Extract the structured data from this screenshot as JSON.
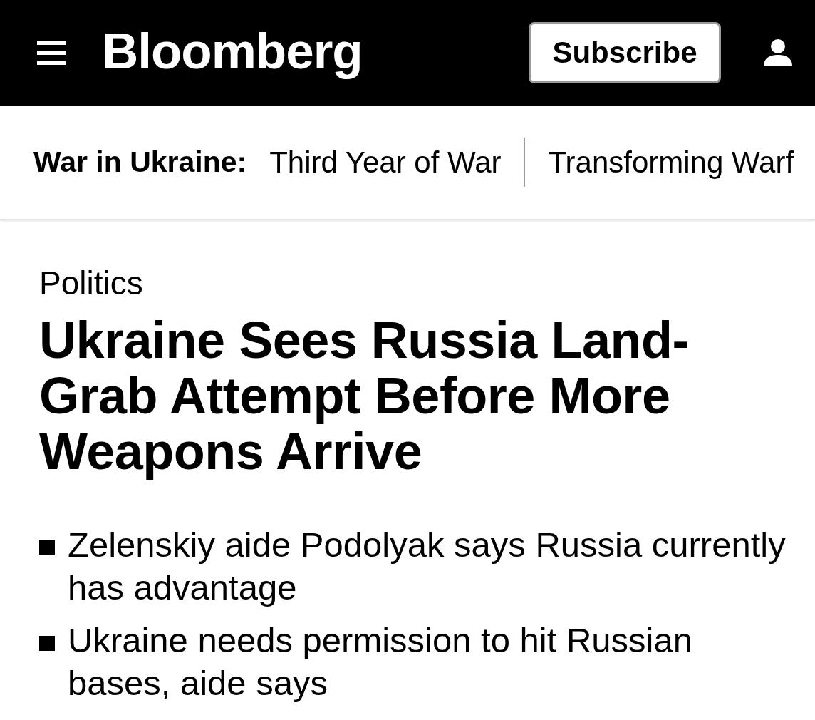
{
  "header": {
    "logo": "Bloomberg",
    "subscribe_button": "Subscribe"
  },
  "topic_bar": {
    "label": "War in Ukraine:",
    "links": [
      "Third Year of War",
      "Transforming Warf"
    ]
  },
  "article": {
    "section": "Politics",
    "headline": "Ukraine Sees Russia Land-Grab Attempt Before More Weapons Arrive",
    "bullets": [
      "Zelenskiy aide Podolyak says Russia currently has advantage",
      "Ukraine needs permission to hit Russian bases, aide says"
    ]
  }
}
